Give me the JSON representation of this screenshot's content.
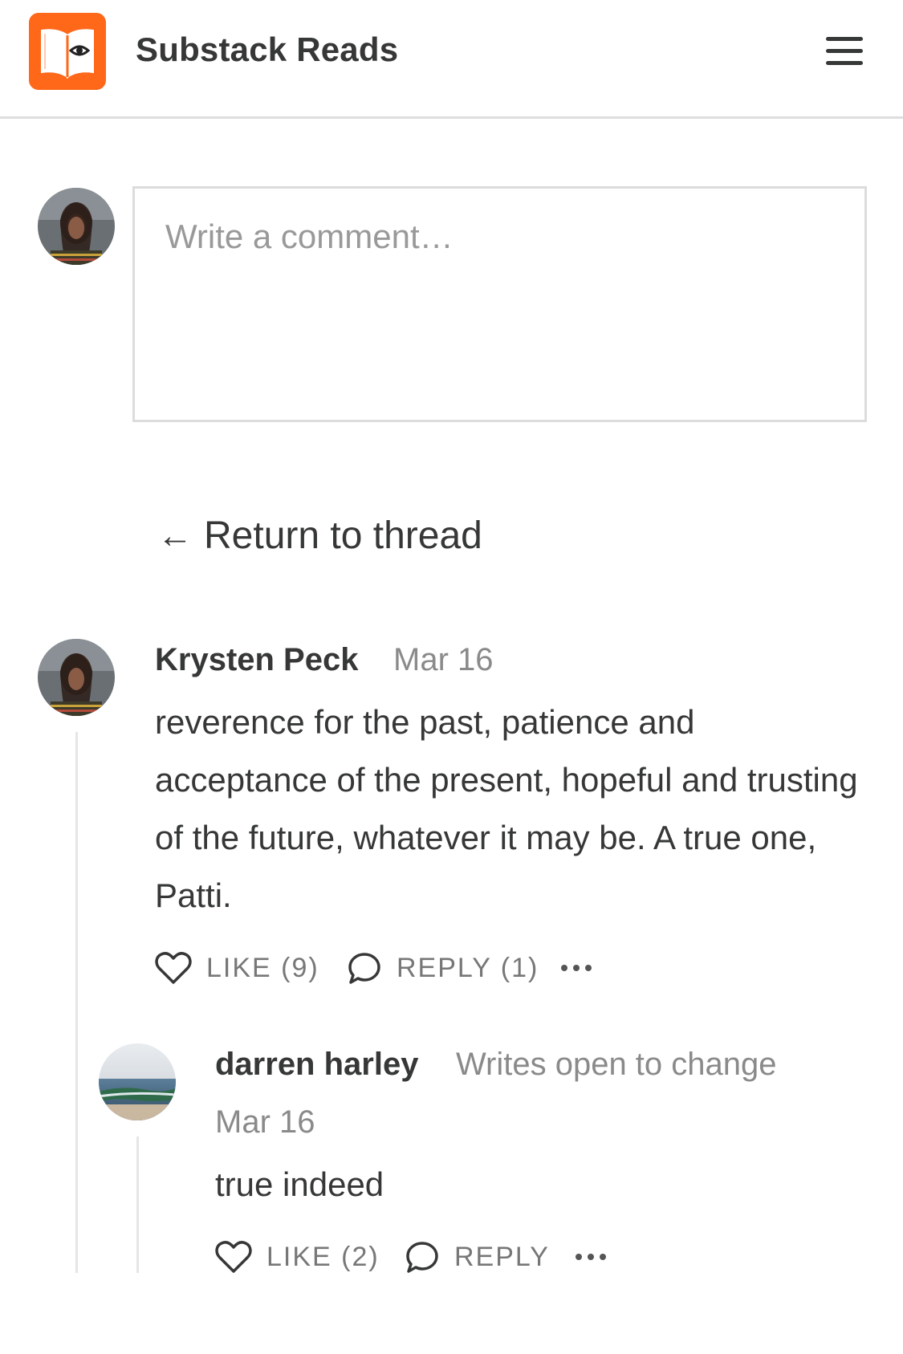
{
  "header": {
    "app_title": "Substack Reads",
    "logo_icon": "book-eye-logo",
    "menu_icon": "hamburger-menu-icon",
    "brand_color": "#ff6719"
  },
  "composer": {
    "placeholder": "Write a comment…",
    "value": ""
  },
  "navigation": {
    "return_arrow": "←",
    "return_label": "Return to thread"
  },
  "comments": [
    {
      "author": "Krysten Peck",
      "date": "Mar 16",
      "body": "reverence for the past, patience and acceptance of the present, hopeful and trusting of the future, whatever it may be. A true one, Patti.",
      "like_label": "LIKE (9)",
      "reply_label": "REPLY (1)",
      "replies": [
        {
          "author": "darren harley",
          "byline": "Writes open to change",
          "date": "Mar 16",
          "body": "true indeed",
          "like_label": "LIKE (2)",
          "reply_label": "REPLY"
        }
      ]
    }
  ]
}
